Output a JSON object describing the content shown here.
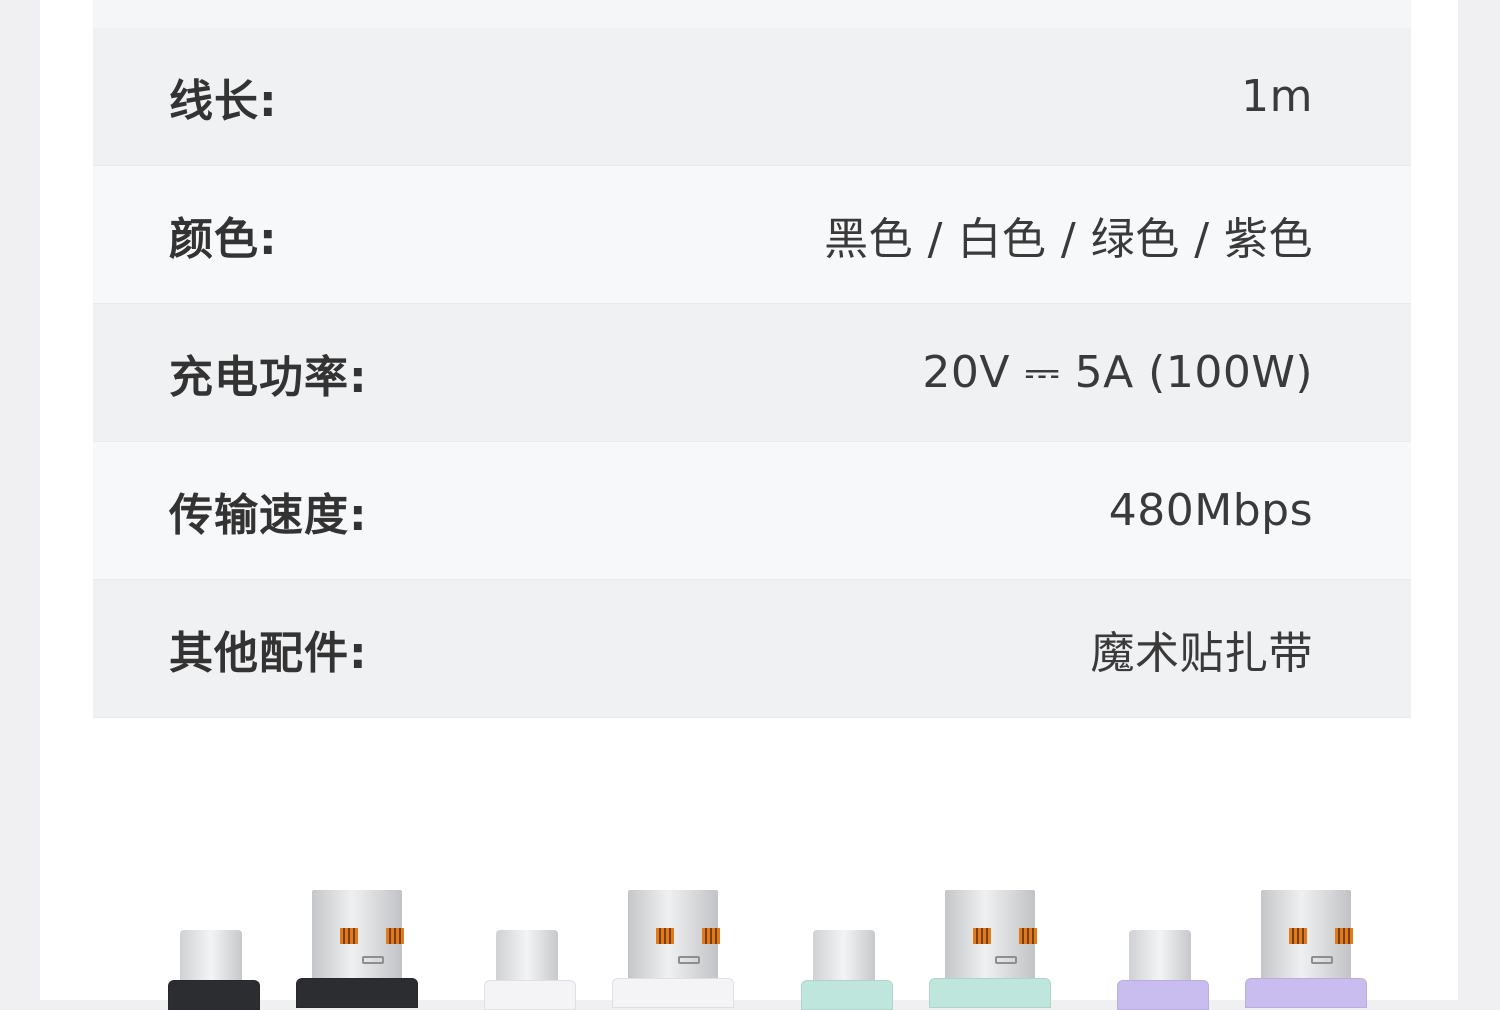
{
  "specs": [
    {
      "label": "线长:",
      "value": "1m"
    },
    {
      "label": "颜色:",
      "value": "黑色 / 白色 / 绿色 / 紫色"
    },
    {
      "label": "充电功率:",
      "value": "20V ⎓ 5A (100W)"
    },
    {
      "label": "传输速度:",
      "value": "480Mbps"
    },
    {
      "label": "其他配件:",
      "value": "魔术贴扎带"
    }
  ],
  "cable_colors": [
    "#2b2d31",
    "#f4f4f6",
    "#bfe6dc",
    "#c9bdf0"
  ]
}
